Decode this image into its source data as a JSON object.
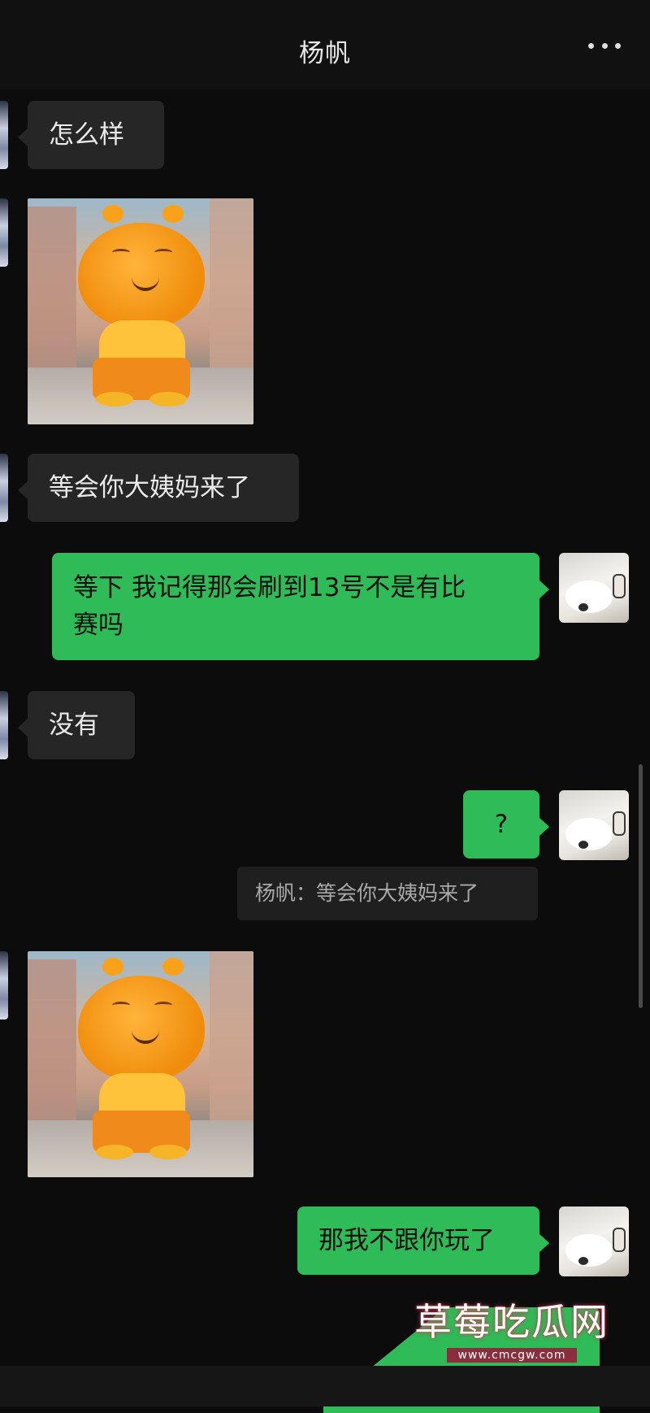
{
  "header": {
    "title": "杨帆",
    "more_icon": "more-dots-icon"
  },
  "messages": {
    "m1": "怎么样",
    "m3": "等会你大姨妈来了",
    "m4": "等下 我记得那会刷到13号不是有比\n赛吗",
    "m5": "没有",
    "m6": "?",
    "m6_quote": "杨帆：等会你大姨妈来了",
    "m8": "那我不跟你玩了"
  },
  "watermark": {
    "text": "草莓吃瓜网",
    "url": "www.cmcgw.com"
  },
  "colors": {
    "outgoing": "#2fbb57",
    "incoming": "#262626",
    "background": "#0c0c0c"
  }
}
